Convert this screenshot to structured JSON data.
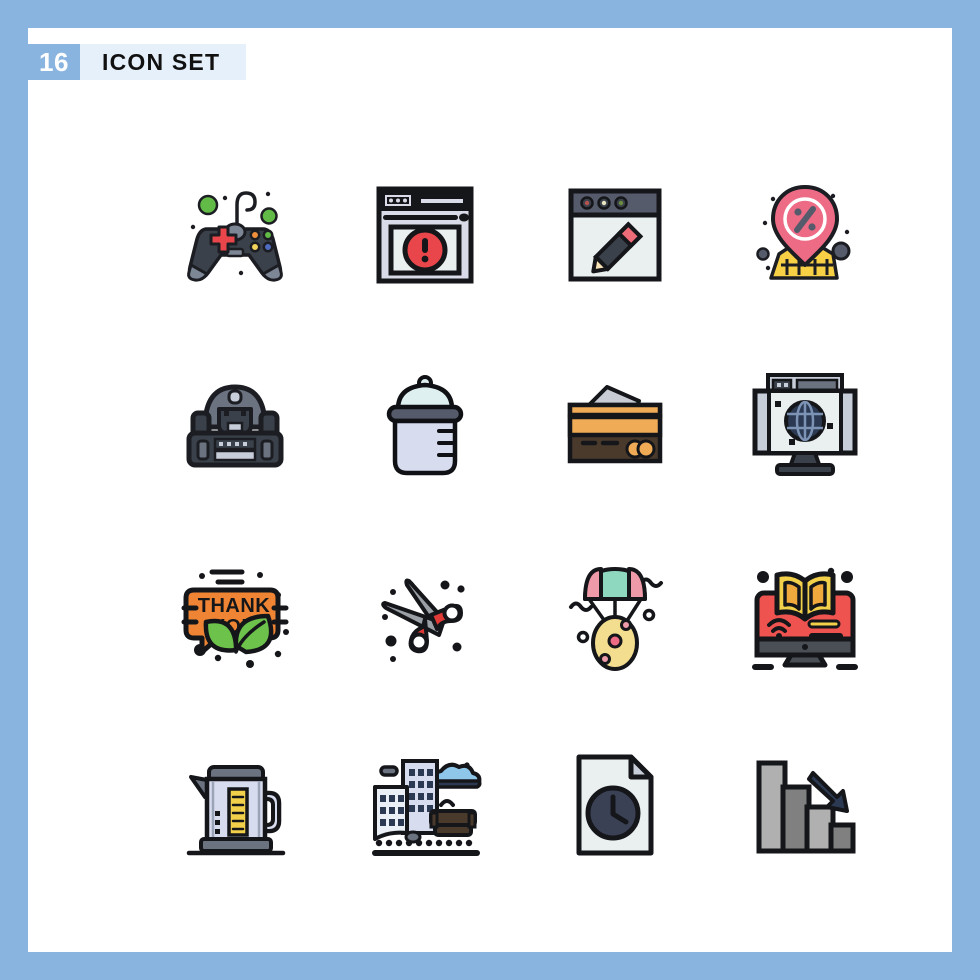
{
  "page": {
    "frame_color": "#8ab4e0",
    "canvas_color": "#ffffff",
    "header_bg": "#e6f0fa",
    "badge_bg": "#8ab4e0"
  },
  "header": {
    "count": "16",
    "title": "ICON SET"
  },
  "grid": {
    "columns": 4,
    "rows": 4,
    "icons": [
      {
        "name": "game-controller-icon",
        "label": "Game Controller",
        "colors": [
          "#3b414b",
          "#7d8694",
          "#e8464a",
          "#62bb46",
          "#ef8f3c",
          "#f3d35a",
          "#4f6bbf"
        ]
      },
      {
        "name": "browser-error-icon",
        "label": "Browser Error Alert",
        "colors": [
          "#15161a",
          "#d9dce8",
          "#eaf0f0",
          "#e8464a"
        ]
      },
      {
        "name": "browser-edit-pencil-icon",
        "label": "Browser Edit Pencil",
        "colors": [
          "#555b6b",
          "#eaf0f0",
          "#3b414b",
          "#ee6b78",
          "#f7e3b5"
        ]
      },
      {
        "name": "location-discount-icon",
        "label": "Location Pin Discount",
        "colors": [
          "#ee6b86",
          "#f7d046",
          "#555b6b",
          "#ffffff"
        ]
      },
      {
        "name": "robot-machine-icon",
        "label": "Robot Machine",
        "colors": [
          "#6b7280",
          "#3b414b",
          "#c7cdd9",
          "#1b1d22"
        ]
      },
      {
        "name": "baby-bottle-icon",
        "label": "Baby Bottle",
        "colors": [
          "#dff0f0",
          "#d7dcee",
          "#555b6b",
          "#0f1114"
        ]
      },
      {
        "name": "credit-card-icon",
        "label": "Credit Card",
        "colors": [
          "#4a3a2c",
          "#efab55",
          "#c9ccd4",
          "#15161a"
        ]
      },
      {
        "name": "monitor-globe-icon",
        "label": "Monitor Internet Globe",
        "colors": [
          "#eaf0f0",
          "#c7cdd9",
          "#2b3a52",
          "#15161a"
        ]
      },
      {
        "name": "thank-you-leaf-icon",
        "label": "Thank You Leaves",
        "colors": [
          "#ef8534",
          "#6cc24a",
          "#15161a"
        ]
      },
      {
        "name": "scissors-icon",
        "label": "Scissors",
        "colors": [
          "#e03a36",
          "#9aa0a6",
          "#15161a"
        ]
      },
      {
        "name": "parachute-egg-icon",
        "label": "Parachute Easter Egg",
        "colors": [
          "#ee9aa8",
          "#8fd8c0",
          "#f3dd8e",
          "#ee6b86",
          "#15161a"
        ]
      },
      {
        "name": "online-learning-icon",
        "label": "Online Learning Book",
        "colors": [
          "#ef5350",
          "#f3d04a",
          "#f0a93c",
          "#4a4f55",
          "#15161a"
        ]
      },
      {
        "name": "electric-kettle-icon",
        "label": "Electric Kettle",
        "colors": [
          "#d7dcee",
          "#6b7280",
          "#f3d04a",
          "#f7e3b5",
          "#15161a"
        ]
      },
      {
        "name": "city-buildings-icon",
        "label": "City Buildings",
        "colors": [
          "#d7dcee",
          "#eaf0f6",
          "#4a3a2c",
          "#8ec7ea",
          "#15161a"
        ]
      },
      {
        "name": "document-clock-icon",
        "label": "Document Clock",
        "colors": [
          "#eaf0f0",
          "#3b4155",
          "#c7cdd9",
          "#15161a"
        ]
      },
      {
        "name": "declining-bar-chart-icon",
        "label": "Declining Bar Chart",
        "colors": [
          "#b0b0b0",
          "#808080",
          "#2b3a52",
          "#15161a"
        ]
      }
    ]
  }
}
